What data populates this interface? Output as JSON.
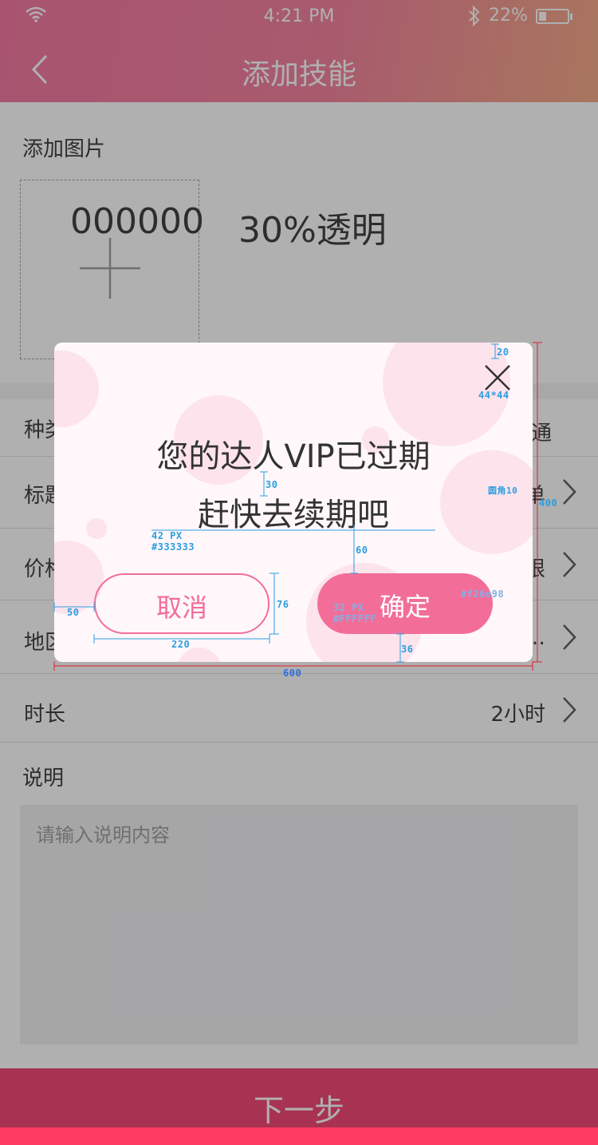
{
  "status_bar": {
    "time": "4:21 PM",
    "battery": "22%"
  },
  "nav": {
    "title": "添加技能"
  },
  "upload": {
    "label": "添加图片"
  },
  "annotation": {
    "color_code": "000000",
    "opacity_note": "30%透明"
  },
  "rows": [
    {
      "label": "种类",
      "value": "普通"
    },
    {
      "label": "标题",
      "value": "标单"
    },
    {
      "label": "价格",
      "value": "无限"
    },
    {
      "label": "地区",
      "value": "…"
    },
    {
      "label": "时长",
      "value": "2小时"
    }
  ],
  "description": {
    "label": "说明",
    "placeholder": "请输入说明内容"
  },
  "next_button": {
    "label": "下一步"
  },
  "dialog": {
    "line1": "您的达人VIP已过期",
    "line2": "赶快去续期吧",
    "cancel_label": "取消",
    "confirm_label": "确定"
  },
  "spec_annotations": {
    "top_gap": "20",
    "close_size": "44*44",
    "corner": "圆角10",
    "dialog_height": "400",
    "line_gap": "30",
    "font_spec": "42 PX",
    "font_color": "#333333",
    "text_to_button_gap": "60",
    "button_height": "76",
    "side_margin": "50",
    "button_width": "220",
    "bottom_margin": "36",
    "dialog_width": "600",
    "button_font_spec": "32 PX",
    "button_font_color": "#FFFFFF",
    "button_color": "#f26e98"
  },
  "colors": {
    "brand_pink": "#f26e98",
    "next_button": "#f23b6a",
    "header_from": "#f2709a",
    "header_to": "#f3a57e"
  }
}
